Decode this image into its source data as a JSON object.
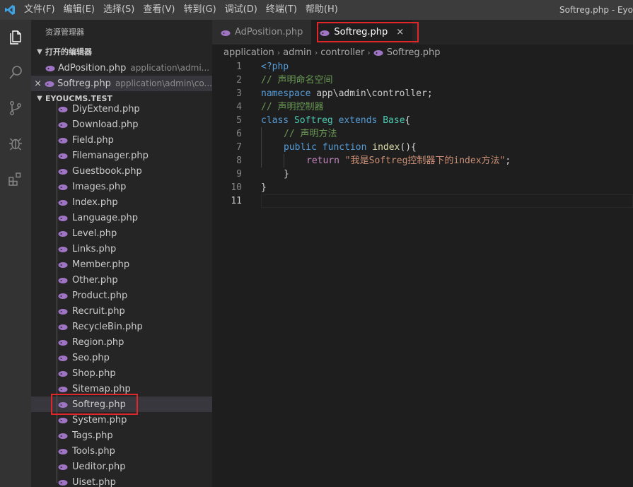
{
  "titlebar": {
    "menu": [
      "文件(F)",
      "编辑(E)",
      "选择(S)",
      "查看(V)",
      "转到(G)",
      "调试(D)",
      "终端(T)",
      "帮助(H)"
    ],
    "window_title": "Softreg.php - Eyo"
  },
  "sidebar": {
    "title": "资源管理器",
    "open_editors_header": "打开的编辑器",
    "open_editors": [
      {
        "name": "AdPosition.php",
        "path": "application\\admi..."
      },
      {
        "name": "Softreg.php",
        "path": "application\\admin\\co..."
      }
    ],
    "close_glyph": "×",
    "project_header": "EYOUCMS.TEST",
    "files": [
      "DiyExtend.php",
      "Download.php",
      "Field.php",
      "Filemanager.php",
      "Guestbook.php",
      "Images.php",
      "Index.php",
      "Language.php",
      "Level.php",
      "Links.php",
      "Member.php",
      "Other.php",
      "Product.php",
      "Recruit.php",
      "RecycleBin.php",
      "Region.php",
      "Seo.php",
      "Shop.php",
      "Sitemap.php",
      "Softreg.php",
      "System.php",
      "Tags.php",
      "Tools.php",
      "Ueditor.php",
      "Uiset.php"
    ]
  },
  "tabs": [
    {
      "label": "AdPosition.php"
    },
    {
      "label": "Softreg.php",
      "close": "×"
    }
  ],
  "breadcrumb": [
    "application",
    "admin",
    "controller",
    "Softreg.php"
  ],
  "editor": {
    "line_numbers": [
      "1",
      "2",
      "3",
      "4",
      "5",
      "6",
      "7",
      "8",
      "9",
      "10",
      "11"
    ],
    "code": {
      "l1": "<?php",
      "l2": "// 声明命名空间",
      "l3_kw": "namespace",
      "l3_ns": " app\\admin\\controller",
      "l3_end": ";",
      "l4": "// 声明控制器",
      "l5_kw1": "class",
      "l5_cls": " Softreg ",
      "l5_kw2": "extends",
      "l5_base": " Base",
      "l5_end": "{",
      "l6": "// 声明方法",
      "l7_kw1": "public",
      "l7_kw2": " function",
      "l7_fn": " index",
      "l7_end": "(){",
      "l8_kw": "return",
      "l8_str": " \"我是Softreg控制器下的index方法\"",
      "l8_end": ";",
      "l9": "}",
      "l10": "}"
    }
  },
  "colors": {
    "highlight_border": "#e0262b",
    "php_icon": "#a074c4"
  }
}
